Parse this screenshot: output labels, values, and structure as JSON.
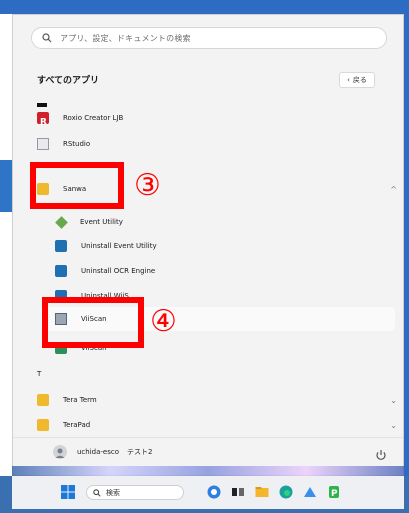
{
  "search": {
    "placeholder": "アプリ、設定、ドキュメントの検索"
  },
  "all_apps": {
    "title": "すべてのアプリ",
    "back_label": "戻る"
  },
  "apps": [
    {
      "name": "Roxio Creator LJB"
    },
    {
      "name": "RStudio"
    },
    {
      "name": "Sanwa"
    },
    {
      "name": "Event Utility"
    },
    {
      "name": "Uninstall Event Utility"
    },
    {
      "name": "Uninstall OCR Engine"
    },
    {
      "name": "Uninstall WiiS"
    },
    {
      "name": "ViiScan"
    },
    {
      "name": "ViiScan"
    },
    {
      "name": "T"
    },
    {
      "name": "Tera Term"
    },
    {
      "name": "TeraPad"
    }
  ],
  "annotations": {
    "three": "③",
    "four": "④"
  },
  "user": {
    "name": "uchida-esco",
    "suffix": "テスト2"
  },
  "taskbar": {
    "search_label": "検索"
  }
}
